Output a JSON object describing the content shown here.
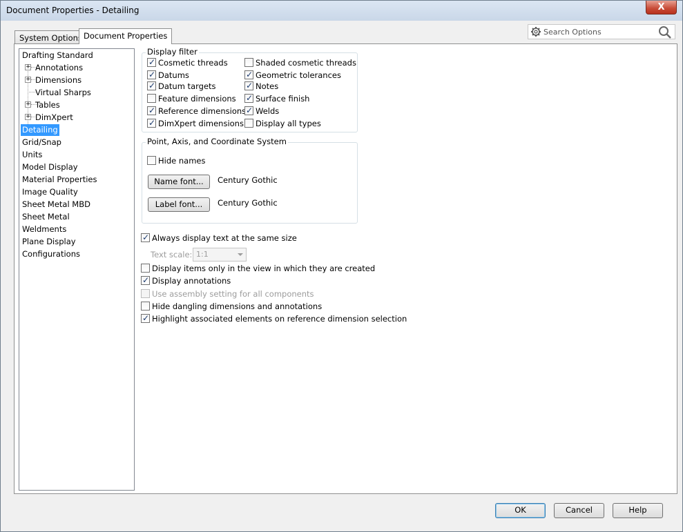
{
  "window": {
    "title": "Document Properties - Detailing",
    "close_label": "X"
  },
  "tabs": [
    {
      "label": "System Options"
    },
    {
      "label": "Document Properties"
    }
  ],
  "search": {
    "placeholder": "Search Options"
  },
  "tree": {
    "items": [
      {
        "label": "Drafting Standard"
      },
      {
        "label": "Annotations"
      },
      {
        "label": "Dimensions"
      },
      {
        "label": "Virtual Sharps"
      },
      {
        "label": "Tables"
      },
      {
        "label": "DimXpert"
      },
      {
        "label": "Detailing"
      },
      {
        "label": "Grid/Snap"
      },
      {
        "label": "Units"
      },
      {
        "label": "Model Display"
      },
      {
        "label": "Material Properties"
      },
      {
        "label": "Image Quality"
      },
      {
        "label": "Sheet Metal MBD"
      },
      {
        "label": "Sheet Metal"
      },
      {
        "label": "Weldments"
      },
      {
        "label": "Plane Display"
      },
      {
        "label": "Configurations"
      }
    ],
    "selected": "Detailing"
  },
  "display_filter": {
    "title": "Display filter",
    "left": [
      {
        "label": "Cosmetic threads",
        "checked": true
      },
      {
        "label": "Datums",
        "checked": true
      },
      {
        "label": "Datum targets",
        "checked": true
      },
      {
        "label": "Feature dimensions",
        "checked": false
      },
      {
        "label": "Reference dimensions",
        "checked": true
      },
      {
        "label": "DimXpert dimensions",
        "checked": true
      }
    ],
    "right": [
      {
        "label": "Shaded cosmetic threads",
        "checked": false
      },
      {
        "label": "Geometric tolerances",
        "checked": true
      },
      {
        "label": "Notes",
        "checked": true
      },
      {
        "label": "Surface finish",
        "checked": true
      },
      {
        "label": "Welds",
        "checked": true
      },
      {
        "label": "Display all types",
        "checked": false
      }
    ]
  },
  "point_axis": {
    "title": "Point, Axis, and Coordinate System",
    "hide_names": {
      "label": "Hide names",
      "checked": false
    },
    "name_font_button": "Name font...",
    "name_font_value": "Century Gothic",
    "label_font_button": "Label font...",
    "label_font_value": "Century Gothic"
  },
  "options": {
    "always_same_size": {
      "label": "Always display text at the same size",
      "checked": true
    },
    "text_scale_label": "Text scale:",
    "text_scale_value": "1:1",
    "display_only_in_view": {
      "label": "Display items only in the view in which they are created",
      "checked": false
    },
    "display_annotations": {
      "label": "Display annotations",
      "checked": true
    },
    "use_assembly_setting": {
      "label": "Use assembly setting for all components",
      "checked": false,
      "disabled": true
    },
    "hide_dangling": {
      "label": "Hide dangling dimensions and annotations",
      "checked": false
    },
    "highlight_associated": {
      "label": "Highlight associated elements on reference dimension selection",
      "checked": true
    }
  },
  "footer": {
    "ok": "OK",
    "cancel": "Cancel",
    "help": "Help"
  }
}
